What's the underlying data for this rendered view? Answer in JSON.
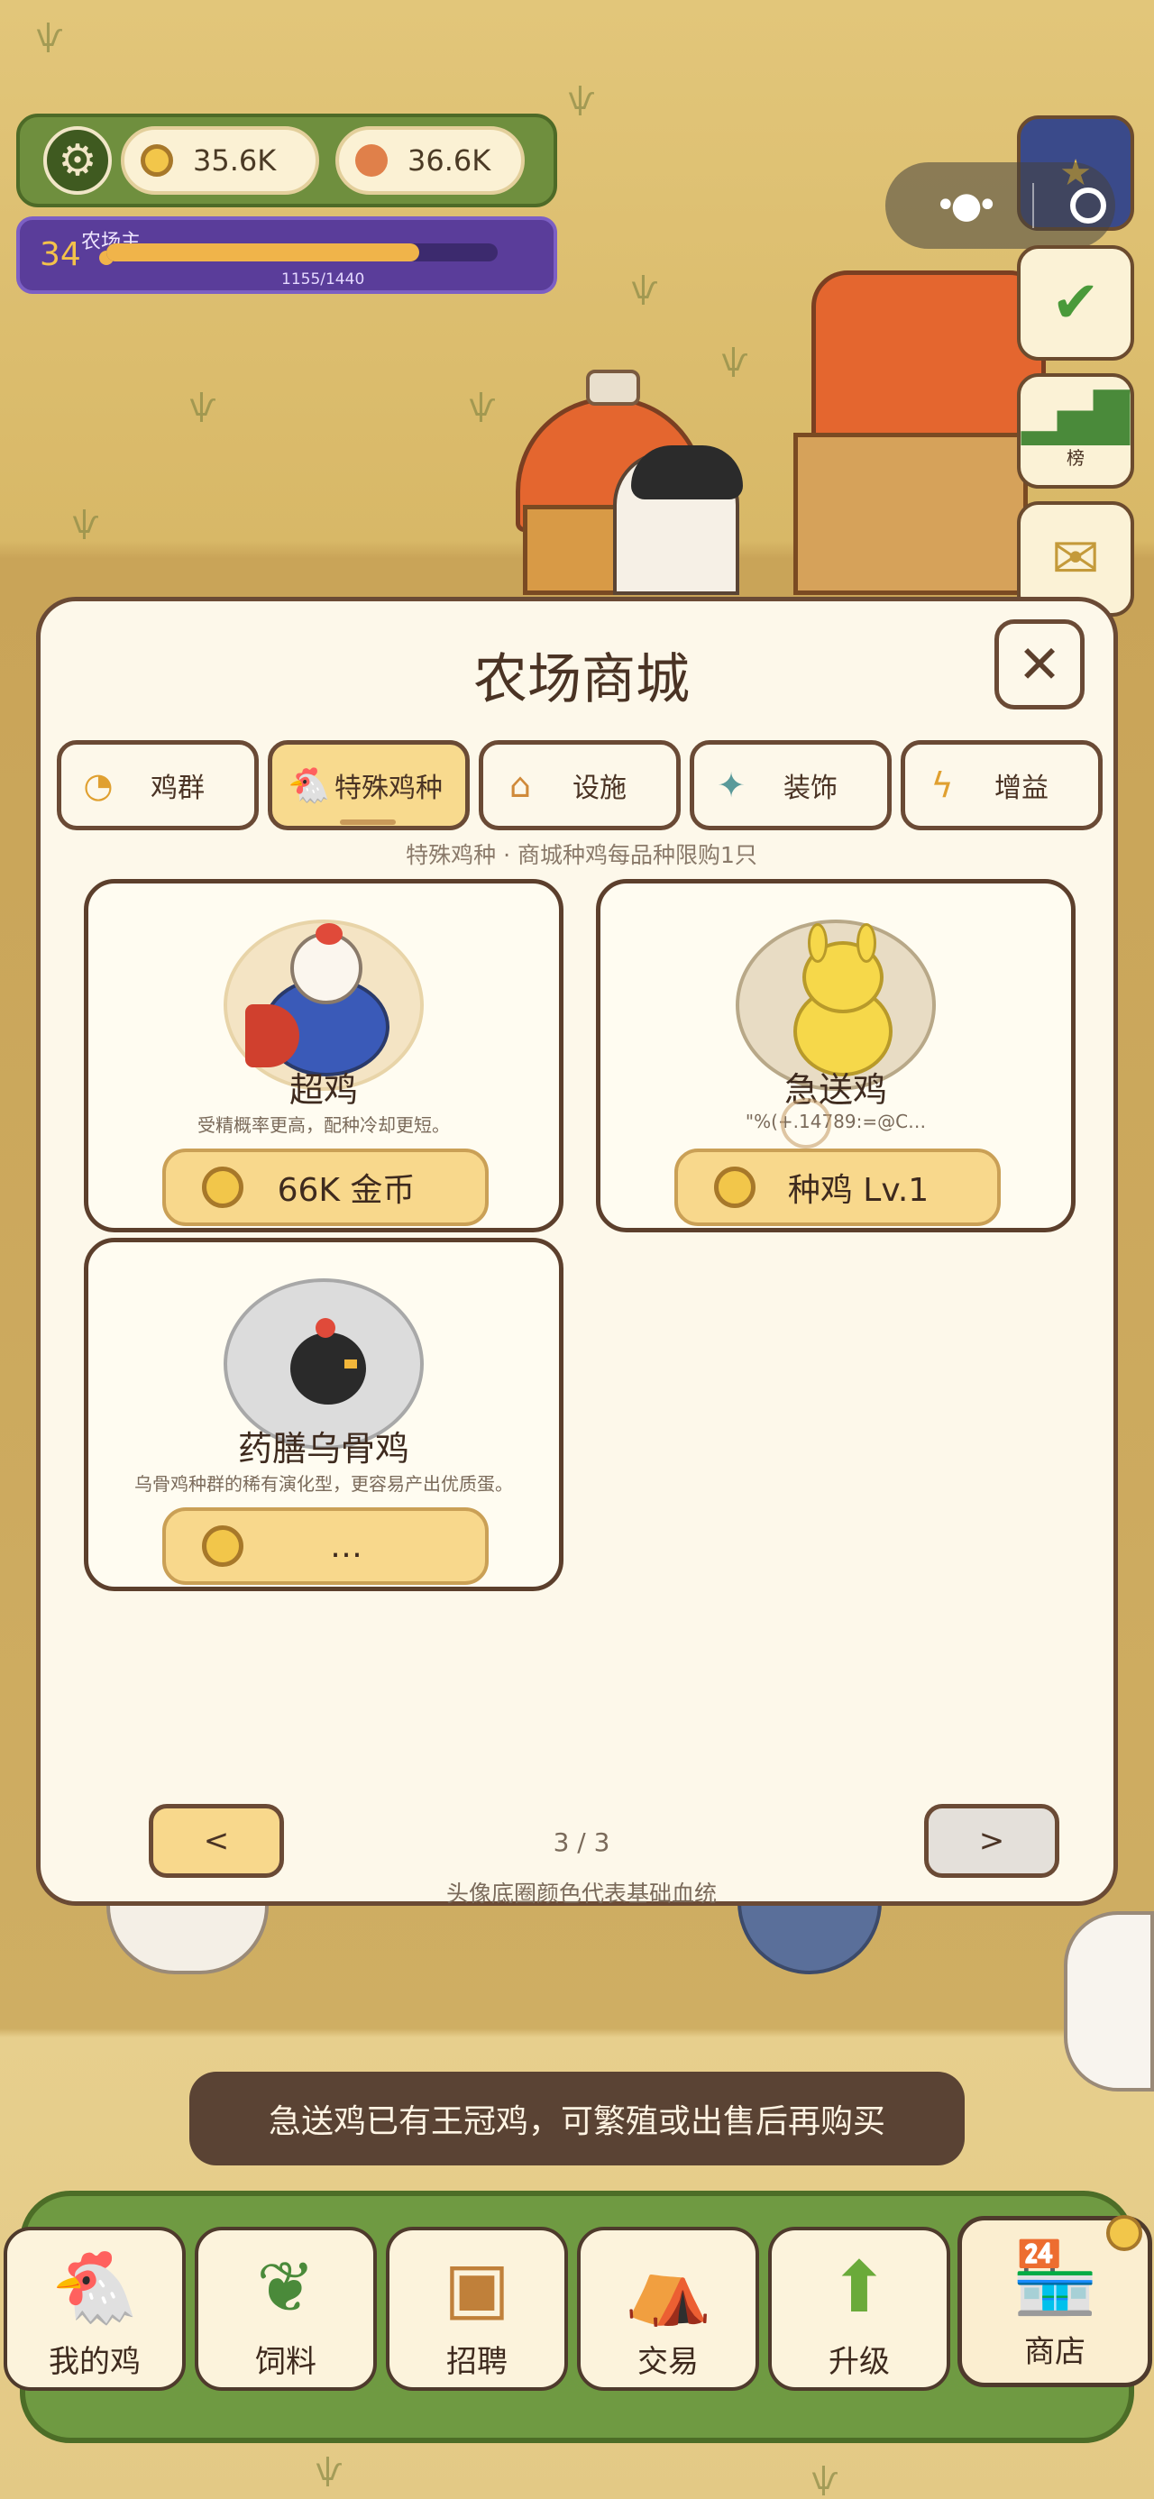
{
  "hud": {
    "coins": "35.6K",
    "eggs": "36.6K"
  },
  "level": {
    "number": "34",
    "title": "农场主",
    "xp_text": "1155/1440",
    "xp_fraction": 0.8
  },
  "side_icons": [
    {
      "name": "globe-icon",
      "label": ""
    },
    {
      "name": "calendar-checkin-icon",
      "label": ""
    },
    {
      "name": "leaderboard-icon",
      "label": "榜"
    },
    {
      "name": "mail-icon",
      "label": ""
    }
  ],
  "shop": {
    "title": "农场商城",
    "tabs": [
      {
        "label": "鸡群",
        "icon": "chick-icon"
      },
      {
        "label": "特殊鸡种",
        "icon": "special-chicken-icon",
        "active": true
      },
      {
        "label": "设施",
        "icon": "house-icon"
      },
      {
        "label": "装饰",
        "icon": "sparkle-icon"
      },
      {
        "label": "增益",
        "icon": "lightning-icon"
      }
    ],
    "subtitle": "特殊鸡种 · 商城种鸡每品种限购1只",
    "cards": [
      {
        "name": "超鸡",
        "desc": "受精概率更高，配种冷却更短。",
        "price": "66K 金币",
        "avatar_icon": "super-chicken-icon"
      },
      {
        "name": "急送鸡",
        "desc": "              \"%(+.14789:=@C…",
        "price": "种鸡 Lv.1",
        "avatar_icon": "bunny-chicken-icon"
      },
      {
        "name": "药膳乌骨鸡",
        "desc": "乌骨鸡种群的稀有演化型，更容易产出优质蛋。",
        "price": "      …",
        "avatar_icon": "black-chicken-icon"
      }
    ],
    "prev_label": "<",
    "next_label": ">",
    "page": "3 / 3",
    "legend": "头像底圈颜色代表基础血统"
  },
  "toast": "急送鸡已有王冠鸡，可繁殖或出售后再购买",
  "bottom_nav": [
    {
      "label": "我的鸡",
      "icon": "chicken-icon"
    },
    {
      "label": "饲料",
      "icon": "leaf-icon"
    },
    {
      "label": "招聘",
      "icon": "badge-icon"
    },
    {
      "label": "交易",
      "icon": "market-stall-icon"
    },
    {
      "label": "升级",
      "icon": "up-arrow-icon"
    },
    {
      "label": "商店",
      "icon": "shop-icon",
      "active": true
    }
  ],
  "colors": {
    "accent": "#f8da8e",
    "panel": "#fdf8ea",
    "outline": "#6a4a35",
    "hud_green": "#6f8f3e",
    "level_purple": "#5a3d9a"
  }
}
